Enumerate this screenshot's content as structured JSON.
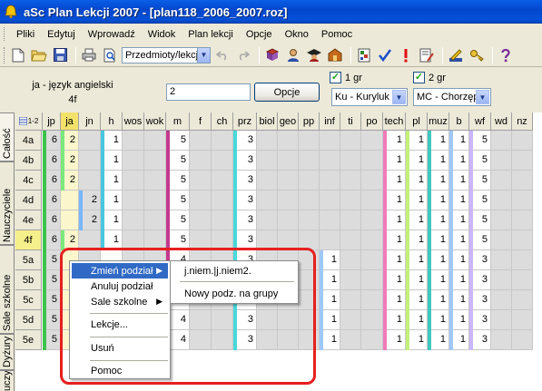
{
  "window": {
    "title": "aSc Plan Lekcji 2007  -  [plan118_2006_2007.roz]"
  },
  "menu": [
    "Pliki",
    "Edytuj",
    "Wprowadź",
    "Widok",
    "Plan lekcji",
    "Opcje",
    "Okno",
    "Pomoc"
  ],
  "toolbar": {
    "view_select": "Przedmioty/lekcje"
  },
  "panel": {
    "subject_title": "ja - język angielski",
    "subject_class": "4f",
    "count_value": "2",
    "options_button": "Opcje",
    "group1_label": "1 gr",
    "group2_label": "2 gr",
    "teacher1": "Ku - Kuryluk J",
    "teacher2": "MC - Chorzęp"
  },
  "left_tabs": [
    "Całość",
    "Nauczyciele",
    "Sale szkolne",
    "Dyżury",
    "Nauczyciele"
  ],
  "grid": {
    "corner": "1-2",
    "columns": [
      "jp",
      "ja",
      "jn",
      "h",
      "wos",
      "wok",
      "m",
      "f",
      "ch",
      "prz",
      "biol",
      "geo",
      "pp",
      "inf",
      "ti",
      "po",
      "tech",
      "pl",
      "muz",
      "b",
      "wf",
      "wd",
      "nz"
    ],
    "selected_column": "ja",
    "selected_row": "4f",
    "rows": [
      {
        "cls": "4a",
        "cells": {
          "jp": "6",
          "ja": "2",
          "h": "1",
          "m": "5",
          "prz": "3",
          "tech": "1",
          "pl": "1",
          "muz": "1",
          "b": "1",
          "wf": "5"
        }
      },
      {
        "cls": "4b",
        "cells": {
          "jp": "6",
          "ja": "2",
          "h": "1",
          "m": "5",
          "prz": "3",
          "tech": "1",
          "pl": "1",
          "muz": "1",
          "b": "1",
          "wf": "5"
        }
      },
      {
        "cls": "4c",
        "cells": {
          "jp": "6",
          "ja": "2",
          "h": "1",
          "m": "5",
          "prz": "3",
          "tech": "1",
          "pl": "1",
          "muz": "1",
          "b": "1",
          "wf": "5"
        }
      },
      {
        "cls": "4d",
        "cells": {
          "jp": "6",
          "jn": "2",
          "h": "1",
          "m": "5",
          "prz": "3",
          "tech": "1",
          "pl": "1",
          "muz": "1",
          "b": "1",
          "wf": "5"
        }
      },
      {
        "cls": "4e",
        "cells": {
          "jp": "6",
          "jn": "2",
          "h": "1",
          "m": "5",
          "prz": "3",
          "tech": "1",
          "pl": "1",
          "muz": "1",
          "b": "1",
          "wf": "5"
        }
      },
      {
        "cls": "4f",
        "cells": {
          "jp": "6",
          "ja": "2",
          "h": "1",
          "m": "5",
          "prz": "3",
          "tech": "1",
          "pl": "1",
          "muz": "1",
          "b": "1",
          "wf": "5"
        }
      },
      {
        "cls": "5a",
        "cells": {
          "jp": "5",
          "m": "4",
          "prz": "3",
          "inf": "1",
          "tech": "1",
          "pl": "1",
          "muz": "1",
          "b": "1",
          "wf": "3"
        }
      },
      {
        "cls": "5b",
        "cells": {
          "jp": "5",
          "m": "4",
          "prz": "3",
          "inf": "1",
          "tech": "1",
          "pl": "1",
          "muz": "1",
          "b": "1",
          "wf": "3"
        }
      },
      {
        "cls": "5c",
        "cells": {
          "jp": "5",
          "m": "4",
          "prz": "3",
          "inf": "1",
          "tech": "1",
          "pl": "1",
          "muz": "1",
          "b": "1",
          "wf": "3"
        }
      },
      {
        "cls": "5d",
        "cells": {
          "jp": "5",
          "m": "4",
          "prz": "3",
          "inf": "1",
          "tech": "1",
          "pl": "1",
          "muz": "1",
          "b": "1",
          "wf": "3"
        }
      },
      {
        "cls": "5e",
        "cells": {
          "jp": "5",
          "m": "4",
          "prz": "3",
          "inf": "1",
          "tech": "1",
          "pl": "1",
          "muz": "1",
          "b": "1",
          "wf": "3"
        }
      }
    ]
  },
  "context_menu": {
    "items": [
      "Zmień podział",
      "Anuluj podział",
      "Sale szkolne",
      "Lekcje...",
      "Usuń",
      "Pomoc"
    ],
    "submenu": [
      "j.niem.|j.niem2.",
      "Nowy podz. na grupy"
    ]
  },
  "colors": {
    "titlebar": "#0450d8",
    "selection": "#316ac5",
    "annotation": "#e52020"
  }
}
